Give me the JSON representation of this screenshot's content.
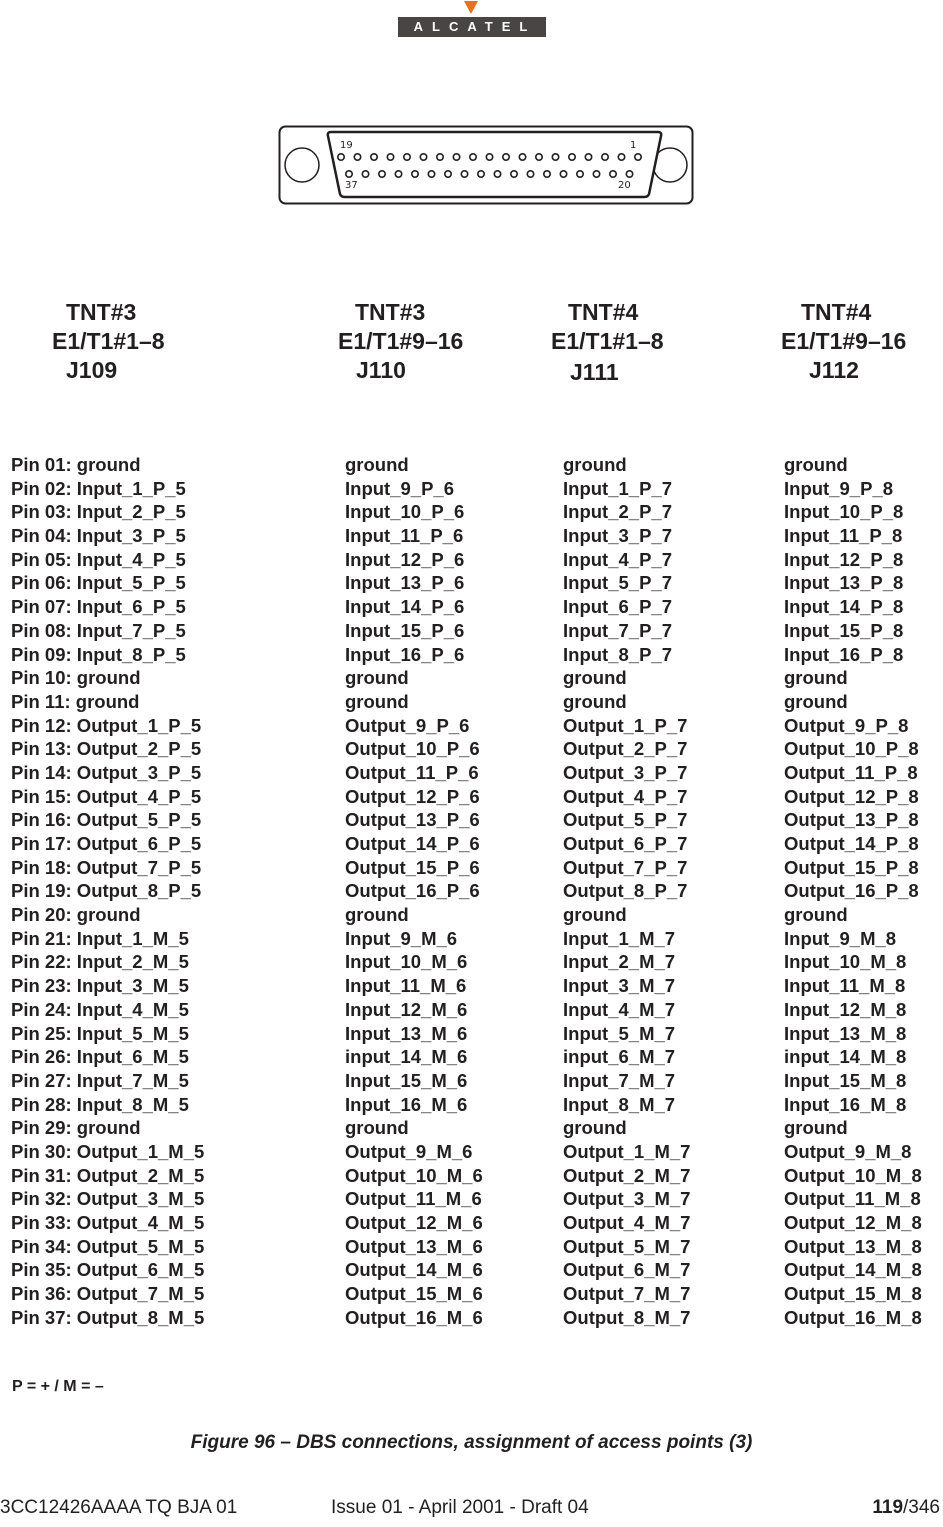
{
  "logo": {
    "text": "ALCATEL",
    "brand_color": "#ea6f1e",
    "bar_color": "#4a4545"
  },
  "connector": {
    "pin_labels": {
      "top_left": "19",
      "top_right": "1",
      "bottom_left": "37",
      "bottom_right": "20"
    },
    "top_row_pins": 19,
    "bottom_row_pins": 18
  },
  "headers": [
    {
      "tnt": "TNT#3",
      "range": "E1/T1#1–8",
      "jack": "J109"
    },
    {
      "tnt": "TNT#3",
      "range": "E1/T1#9–16",
      "jack": "J110"
    },
    {
      "tnt": "TNT#4",
      "range": "E1/T1#1–8",
      "jack": "J111"
    },
    {
      "tnt": "TNT#4",
      "range": "E1/T1#9–16",
      "jack": "J112"
    }
  ],
  "pins": [
    "Pin 01: ground",
    "Pin 02: Input_1_P_5",
    "Pin 03: Input_2_P_5",
    "Pin 04: Input_3_P_5",
    "Pin 05: Input_4_P_5",
    "Pin 06: Input_5_P_5",
    "Pin 07: Input_6_P_5",
    "Pin 08: Input_7_P_5",
    "Pin 09: Input_8_P_5",
    "Pin 10: ground",
    "Pin 11: ground",
    "Pin 12: Output_1_P_5",
    "Pin 13: Output_2_P_5",
    "Pin 14: Output_3_P_5",
    "Pin 15: Output_4_P_5",
    "Pin 16: Output_5_P_5",
    "Pin 17: Output_6_P_5",
    "Pin 18: Output_7_P_5",
    "Pin 19: Output_8_P_5",
    "Pin 20: ground",
    "Pin 21: Input_1_M_5",
    "Pin 22: Input_2_M_5",
    "Pin 23: Input_3_M_5",
    "Pin 24: Input_4_M_5",
    "Pin 25: Input_5_M_5",
    "Pin 26: Input_6_M_5",
    "Pin 27: Input_7_M_5",
    "Pin 28: Input_8_M_5",
    "Pin 29: ground",
    "Pin 30: Output_1_M_5",
    "Pin 31: Output_2_M_5",
    "Pin 32: Output_3_M_5",
    "Pin 33: Output_4_M_5",
    "Pin 34: Output_5_M_5",
    "Pin 35: Output_6_M_5",
    "Pin 36: Output_7_M_5",
    "Pin 37: Output_8_M_5"
  ],
  "col_j110": [
    "ground",
    "Input_9_P_6",
    "Input_10_P_6",
    "Input_11_P_6",
    "Input_12_P_6",
    "Input_13_P_6",
    "Input_14_P_6",
    "Input_15_P_6",
    "Input_16_P_6",
    "ground",
    "ground",
    "Output_9_P_6",
    "Output_10_P_6",
    "Output_11_P_6",
    "Output_12_P_6",
    "Output_13_P_6",
    "Output_14_P_6",
    "Output_15_P_6",
    "Output_16_P_6",
    "ground",
    "Input_9_M_6",
    "Input_10_M_6",
    "Input_11_M_6",
    "Input_12_M_6",
    "Input_13_M_6",
    "input_14_M_6",
    "Input_15_M_6",
    "Input_16_M_6",
    "ground",
    "Output_9_M_6",
    "Output_10_M_6",
    "Output_11_M_6",
    "Output_12_M_6",
    "Output_13_M_6",
    "Output_14_M_6",
    "Output_15_M_6",
    "Output_16_M_6"
  ],
  "col_j111": [
    "ground",
    "Input_1_P_7",
    "Input_2_P_7",
    "Input_3_P_7",
    "Input_4_P_7",
    "Input_5_P_7",
    "Input_6_P_7",
    "Input_7_P_7",
    "Input_8_P_7",
    "ground",
    "ground",
    "Output_1_P_7",
    "Output_2_P_7",
    "Output_3_P_7",
    "Output_4_P_7",
    "Output_5_P_7",
    "Output_6_P_7",
    "Output_7_P_7",
    "Output_8_P_7",
    "ground",
    "Input_1_M_7",
    "Input_2_M_7",
    "Input_3_M_7",
    "Input_4_M_7",
    "Input_5_M_7",
    "input_6_M_7",
    "Input_7_M_7",
    "Input_8_M_7",
    "ground",
    "Output_1_M_7",
    "Output_2_M_7",
    "Output_3_M_7",
    "Output_4_M_7",
    "Output_5_M_7",
    "Output_6_M_7",
    "Output_7_M_7",
    "Output_8_M_7"
  ],
  "col_j112": [
    "ground",
    "Input_9_P_8",
    "Input_10_P_8",
    "Input_11_P_8",
    "Input_12_P_8",
    "Input_13_P_8",
    "Input_14_P_8",
    "Input_15_P_8",
    "Input_16_P_8",
    "ground",
    "ground",
    "Output_9_P_8",
    "Output_10_P_8",
    "Output_11_P_8",
    "Output_12_P_8",
    "Output_13_P_8",
    "Output_14_P_8",
    "Output_15_P_8",
    "Output_16_P_8",
    "ground",
    "Input_9_M_8",
    "Input_10_M_8",
    "Input_11_M_8",
    "Input_12_M_8",
    "Input_13_M_8",
    "input_14_M_8",
    "Input_15_M_8",
    "Input_16_M_8",
    "ground",
    "Output_9_M_8",
    "Output_10_M_8",
    "Output_11_M_8",
    "Output_12_M_8",
    "Output_13_M_8",
    "Output_14_M_8",
    "Output_15_M_8",
    "Output_16_M_8"
  ],
  "legend": "P = +  / M =  –",
  "caption": "Figure 96 – DBS connections, assignment of access points (3)",
  "footer": {
    "doc_ref": "3CC12426AAAA TQ BJA 01",
    "issue": "Issue 01 - April 2001 - Draft 04",
    "page": "119",
    "total": "/346"
  }
}
